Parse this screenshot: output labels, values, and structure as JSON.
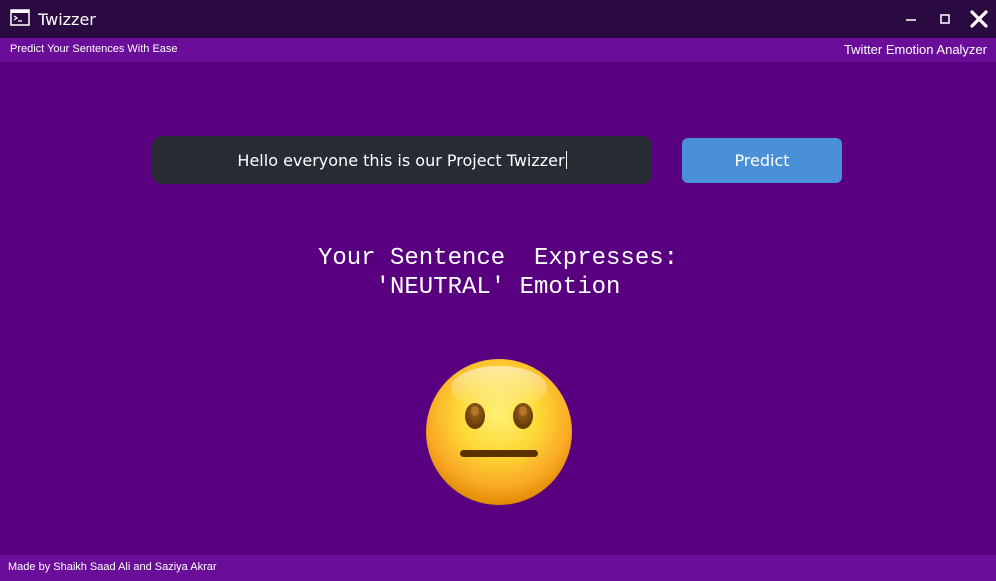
{
  "window": {
    "title": "Twizzer",
    "icon": "terminal-icon",
    "controls": [
      "minimize-icon",
      "maximize-icon",
      "close-icon"
    ]
  },
  "subheader": {
    "left_text": "Predict Your Sentences With Ease",
    "right_text": "Twitter Emotion Analyzer"
  },
  "input": {
    "value": "Hello everyone this is our Project Twizzer"
  },
  "predict_button": {
    "label": "Predict"
  },
  "result": {
    "line1": "Your Sentence  Expresses:",
    "line2": "'NEUTRAL' Emotion"
  },
  "emoji": {
    "icon": "neutral-face-icon"
  },
  "footer": {
    "credits": "Made by Shaikh Saad Ali and Saziya Akrar"
  },
  "colors": {
    "background": "#580080",
    "titlebar": "#2a0a40",
    "subheader": "#6a0e99",
    "input_bg": "#272b33",
    "button": "#4a90d9"
  }
}
